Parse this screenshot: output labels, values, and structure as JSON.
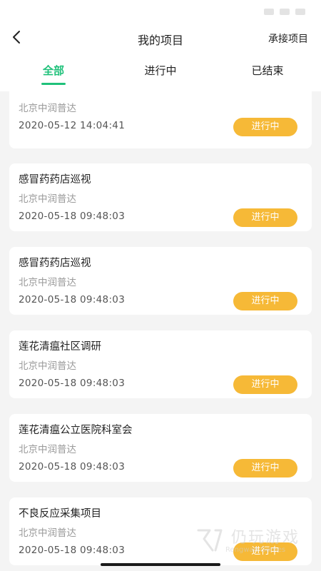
{
  "header": {
    "title": "我的项目",
    "action_label": "承接项目",
    "back_icon": "chevron-left-icon"
  },
  "tabs": [
    {
      "label": "全部",
      "active": true
    },
    {
      "label": "进行中",
      "active": false
    },
    {
      "label": "已结束",
      "active": false
    }
  ],
  "colors": {
    "accent": "#1fc17a",
    "status_badge": "#f6b937",
    "background": "#f4f4f4"
  },
  "projects": [
    {
      "title": "",
      "company": "北京中润普达",
      "date": "2020-05-12 14:04:41",
      "status": "进行中"
    },
    {
      "title": "感冒药药店巡视",
      "company": "北京中润普达",
      "date": "2020-05-18 09:48:03",
      "status": "进行中"
    },
    {
      "title": "感冒药药店巡视",
      "company": "北京中润普达",
      "date": "2020-05-18 09:48:03",
      "status": "进行中"
    },
    {
      "title": "莲花清瘟社区调研",
      "company": "北京中润普达",
      "date": "2020-05-18 09:48:03",
      "status": "进行中"
    },
    {
      "title": "莲花清瘟公立医院科室会",
      "company": "北京中润普达",
      "date": "2020-05-18 09:48:03",
      "status": "进行中"
    },
    {
      "title": "不良反应采集项目",
      "company": "北京中润普达",
      "date": "2020-05-18 09:48:03",
      "status": "进行中"
    }
  ],
  "watermark": {
    "main": "仍玩游戏",
    "sub": "Rengwan Games"
  }
}
